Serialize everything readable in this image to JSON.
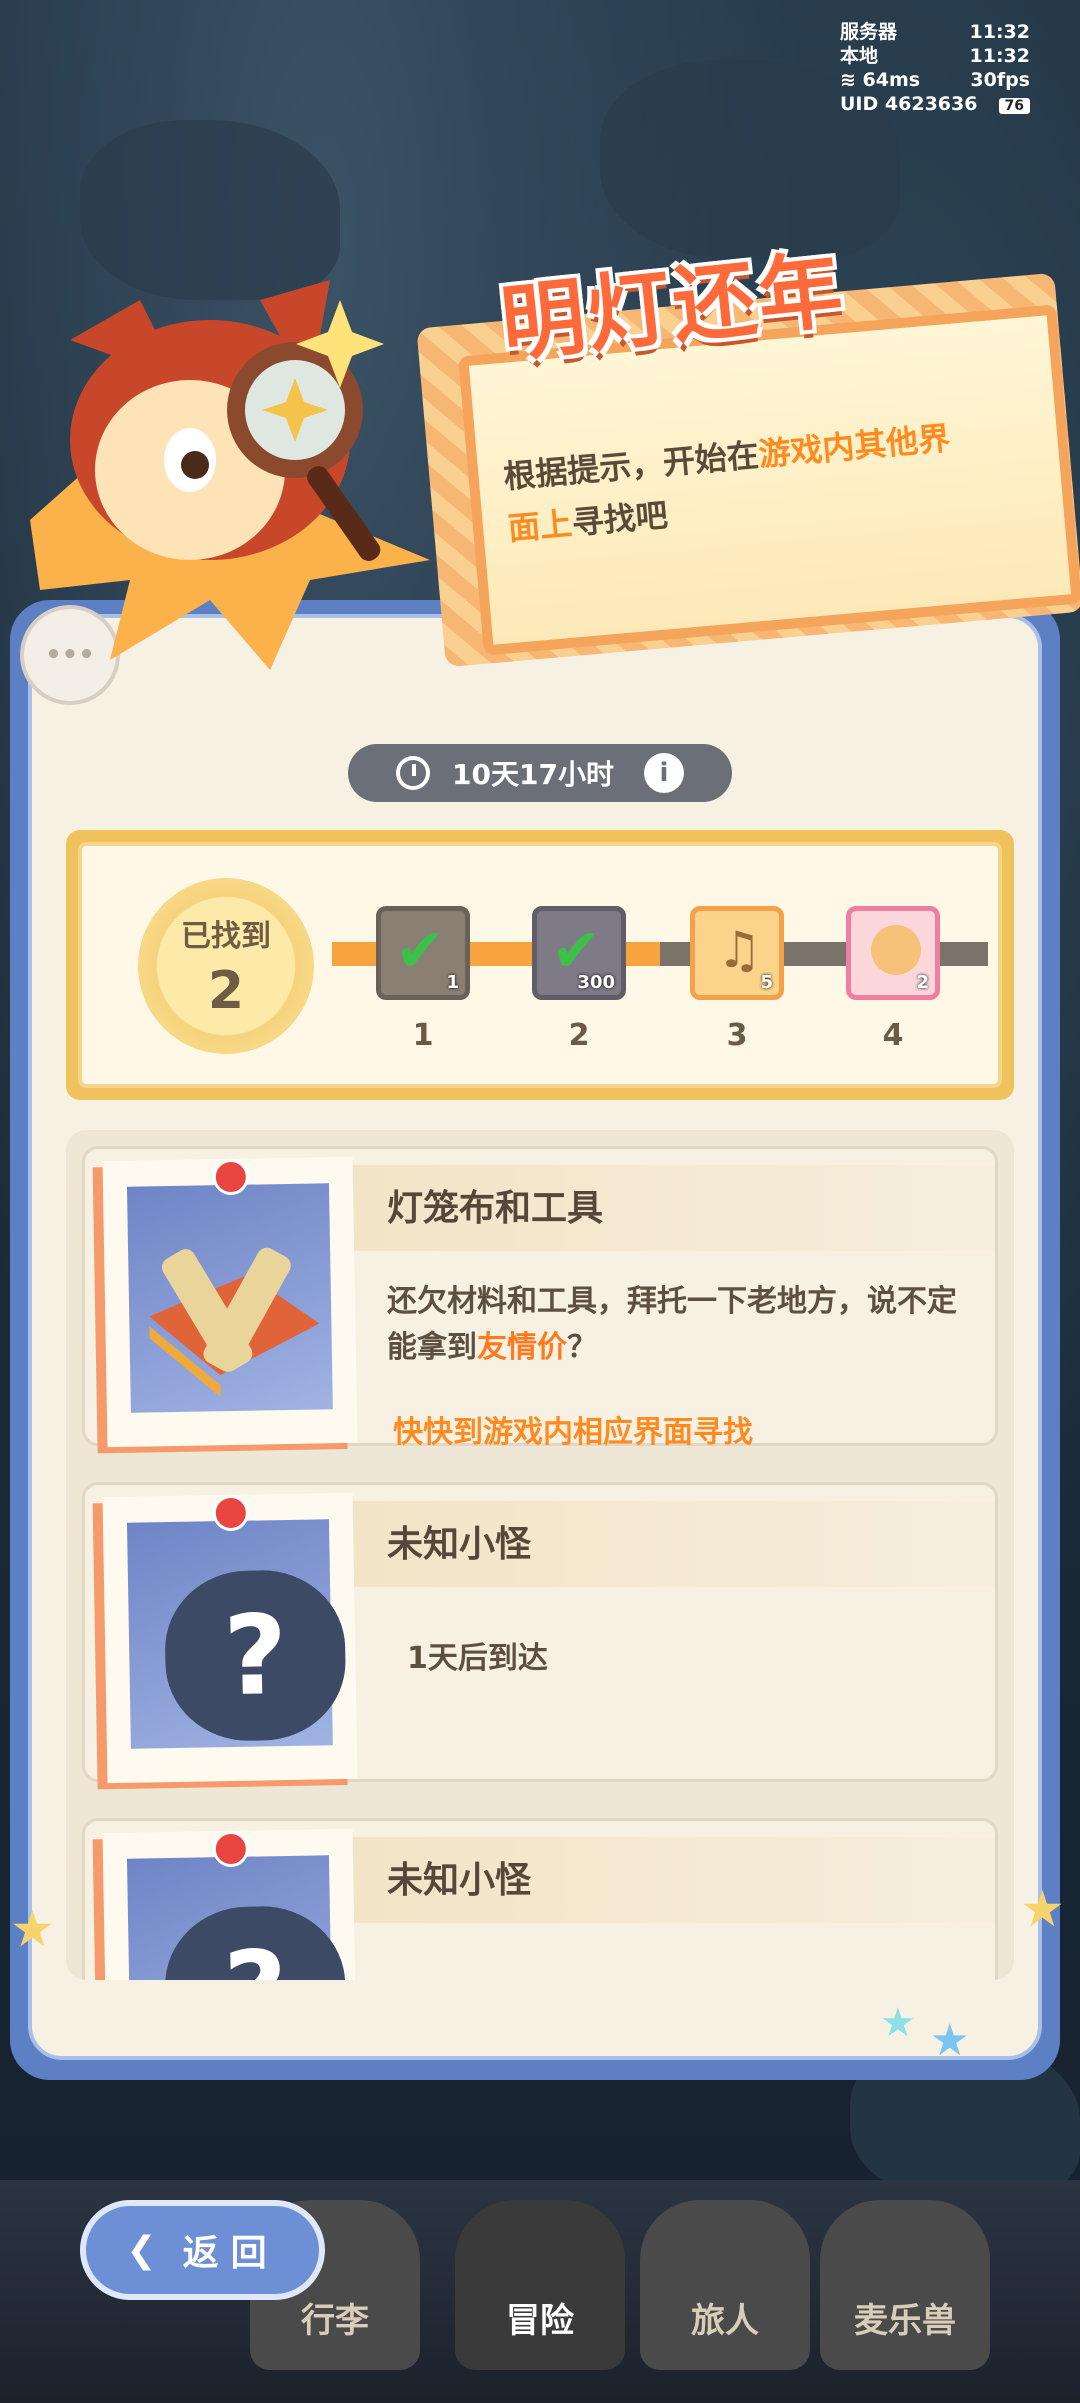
{
  "status": {
    "server_label": "服务器",
    "server_time": "11:32",
    "local_label": "本地",
    "local_time": "11:32",
    "ping": "64ms",
    "fps": "30fps",
    "uid_label": "UID",
    "uid": "4623636",
    "battery": "76"
  },
  "event": {
    "title": "明灯还年",
    "hint_prefix": "根据提示，开始在",
    "hint_highlight": "游戏内其他界面上",
    "hint_suffix": "寻找吧",
    "timer": "10天17小时",
    "info_icon": "i",
    "chat_icon": "•••"
  },
  "progress": {
    "found_label": "已找到",
    "found_count": "2",
    "fill_fraction": 0.5,
    "milestones": [
      {
        "label": "1",
        "count": "1",
        "claimed": true
      },
      {
        "label": "2",
        "count": "300",
        "claimed": true
      },
      {
        "label": "3",
        "count": "5",
        "claimed": false
      },
      {
        "label": "4",
        "count": "2",
        "claimed": false
      }
    ]
  },
  "tasks": [
    {
      "name": "灯笼布和工具",
      "desc_prefix": "还欠材料和工具，拜托一下老地方，说不定能拿到",
      "desc_highlight": "友情价",
      "desc_suffix": "？",
      "action": "快快到游戏内相应界面寻找"
    },
    {
      "name": "未知小怪",
      "wait": "1天后到达",
      "question": "?"
    },
    {
      "name": "未知小怪",
      "question": "?"
    }
  ],
  "nav": {
    "back_label": "返回",
    "items": [
      {
        "label": "行李"
      },
      {
        "label": "冒险"
      },
      {
        "label": "旅人"
      },
      {
        "label": "麦乐兽"
      }
    ]
  },
  "colors": {
    "accent": "#ff8a1e",
    "title": "#ff6a3b",
    "panel": "#5d7fc4"
  }
}
